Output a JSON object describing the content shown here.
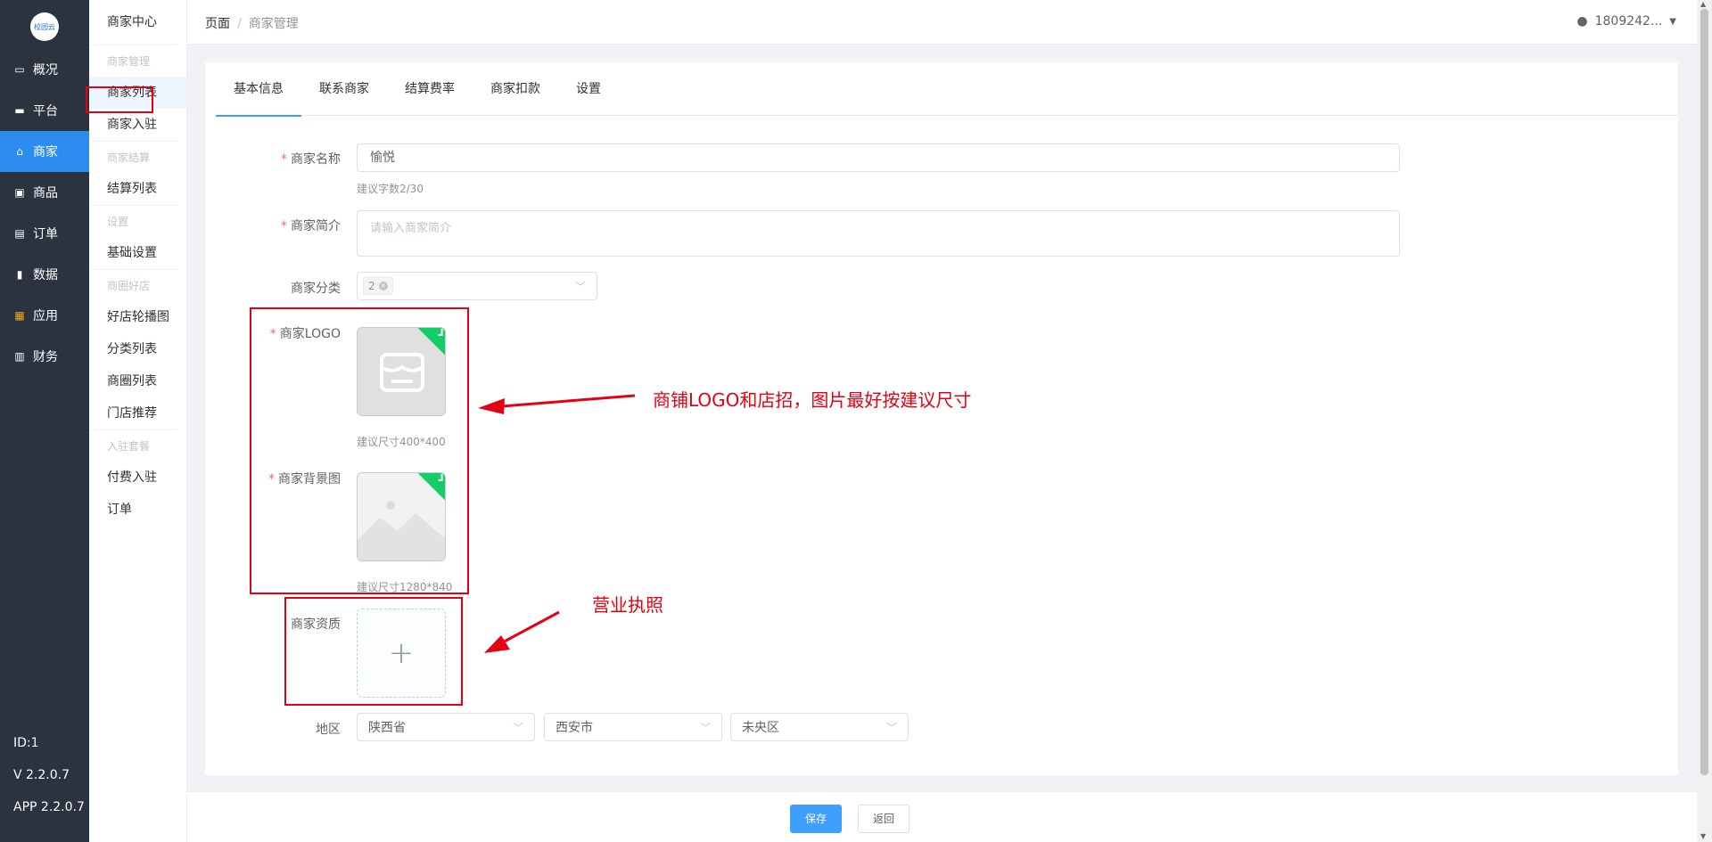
{
  "sidebar": {
    "logo_text": "校园云",
    "items": [
      {
        "label": "概况",
        "icon": "monitor-icon"
      },
      {
        "label": "平台",
        "icon": "desktop-icon"
      },
      {
        "label": "商家",
        "icon": "shop-icon",
        "active": true
      },
      {
        "label": "商品",
        "icon": "goods-icon"
      },
      {
        "label": "订单",
        "icon": "order-icon"
      },
      {
        "label": "数据",
        "icon": "chart-icon"
      },
      {
        "label": "应用",
        "icon": "apps-icon"
      },
      {
        "label": "财务",
        "icon": "finance-icon"
      }
    ],
    "id": "ID:1",
    "version": "V 2.2.0.7",
    "app_version": "APP 2.2.0.7"
  },
  "submenu": {
    "title": "商家中心",
    "groups": [
      {
        "label": "商家管理",
        "items": [
          "商家列表",
          "商家入驻"
        ]
      },
      {
        "label": "商家结算",
        "items": [
          "结算列表"
        ]
      },
      {
        "label": "设置",
        "items": [
          "基础设置"
        ]
      },
      {
        "label": "商圈好店",
        "items": [
          "好店轮播图",
          "分类列表",
          "商圈列表",
          "门店推荐"
        ]
      },
      {
        "label": "入驻套餐",
        "items": [
          "付费入驻",
          "订单"
        ]
      }
    ]
  },
  "header": {
    "crumb1": "页面",
    "crumb_sep": "/",
    "crumb2": "商家管理",
    "user": "1809242..."
  },
  "tabs": [
    "基本信息",
    "联系商家",
    "结算费率",
    "商家扣款",
    "设置"
  ],
  "form": {
    "name_label": "商家名称",
    "name_value": "愉悦",
    "name_hint": "建议字数2/30",
    "intro_label": "商家简介",
    "intro_placeholder": "请输入商家简介",
    "category_label": "商家分类",
    "category_tag": "2",
    "logo_label": "商家LOGO",
    "logo_hint": "建议尺寸400*400",
    "bg_label": "商家背景图",
    "bg_hint": "建议尺寸1280*840",
    "qual_label": "商家资质",
    "region_label": "地区",
    "province": "陕西省",
    "city": "西安市",
    "district": "未央区"
  },
  "annotations": {
    "logo_note": "商铺LOGO和店招，图片最好按建议尺寸",
    "license_note": "营业执照"
  },
  "footer": {
    "save": "保存",
    "back": "返回"
  },
  "colors": {
    "sidebar_bg": "#2b3340",
    "active": "#2d8cf0",
    "primary": "#409eff",
    "annotation": "#e60012",
    "success": "#13ce66"
  }
}
